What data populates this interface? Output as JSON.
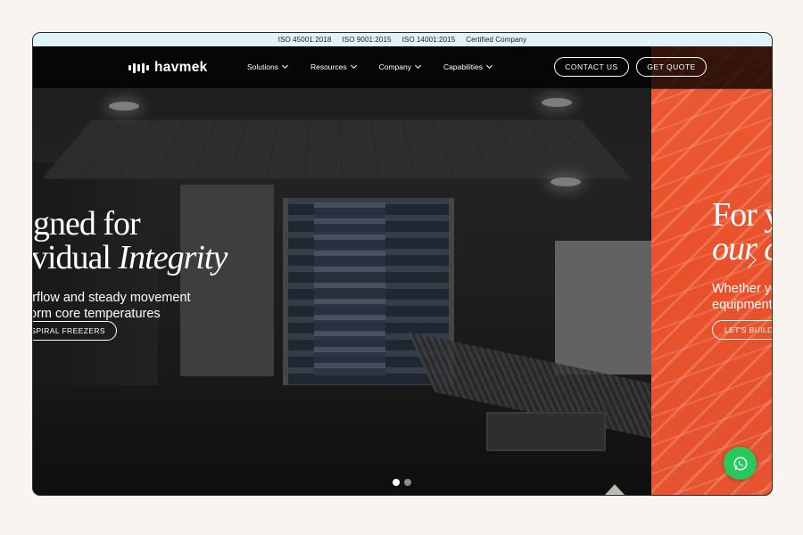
{
  "cert_bar": {
    "items": [
      "ISO 45001:2018",
      "ISO 9001:2015",
      "ISO 14001:2015",
      "Certified Company"
    ]
  },
  "header": {
    "logo_text": "havmek",
    "nav": [
      {
        "label": "Solutions"
      },
      {
        "label": "Resources"
      },
      {
        "label": "Company"
      },
      {
        "label": "Capabilities"
      }
    ],
    "contact_label": "CONTACT US",
    "quote_label": "GET QUOTE"
  },
  "slide_1": {
    "title_line1": "gned for",
    "title_line2_plain": "vidual ",
    "title_line2_italic": "Integrity",
    "subtitle_line1": "irflow and steady movement",
    "subtitle_line2": "orm core temperatures",
    "cta": "F SPIRAL FREEZERS"
  },
  "slide_2": {
    "title_line1": "For y",
    "title_line2_italic": "our c",
    "subtitle_line1": "Whether yo",
    "subtitle_line2": "equipment",
    "cta": "LET'S BUILD"
  },
  "carousel": {
    "slide_count": 2,
    "active_index": 0
  },
  "colors": {
    "cert_bar_bg": "#dff3f8",
    "salmon_slide": "#e9512c",
    "whatsapp_green": "#27c95d",
    "page_bg": "#f8f5f0"
  },
  "icons": {
    "logo": "havmek-bars-logo",
    "chevron": "chevron-down-icon",
    "arrow": "chevron-right-icon",
    "whatsapp": "whatsapp-icon"
  }
}
